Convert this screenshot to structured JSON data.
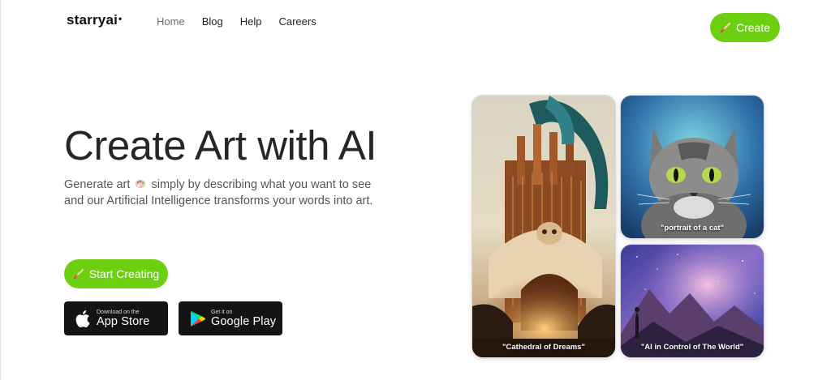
{
  "header": {
    "logo": "starryai",
    "logo_mark": "•",
    "nav": [
      {
        "label": "Home"
      },
      {
        "label": "Blog"
      },
      {
        "label": "Help"
      },
      {
        "label": "Careers"
      }
    ],
    "create_label": "Create"
  },
  "hero": {
    "title": "Create Art with AI",
    "subtitle_before": "Generate art",
    "subtitle_after": "simply by describing what you want to see and our Artificial Intelligence transforms your words into art.",
    "cta_label": "Start Creating"
  },
  "stores": {
    "apple": {
      "small": "Download on the",
      "big": "App Store"
    },
    "google": {
      "small": "Get it on",
      "big": "Google Play"
    }
  },
  "gallery": [
    {
      "caption": "\"Cathedral of Dreams\""
    },
    {
      "caption": "\"portrait of a cat\""
    },
    {
      "caption": "\"AI in Control of The World\""
    }
  ],
  "colors": {
    "accent": "#6ccf10",
    "store_bg": "#141414"
  }
}
